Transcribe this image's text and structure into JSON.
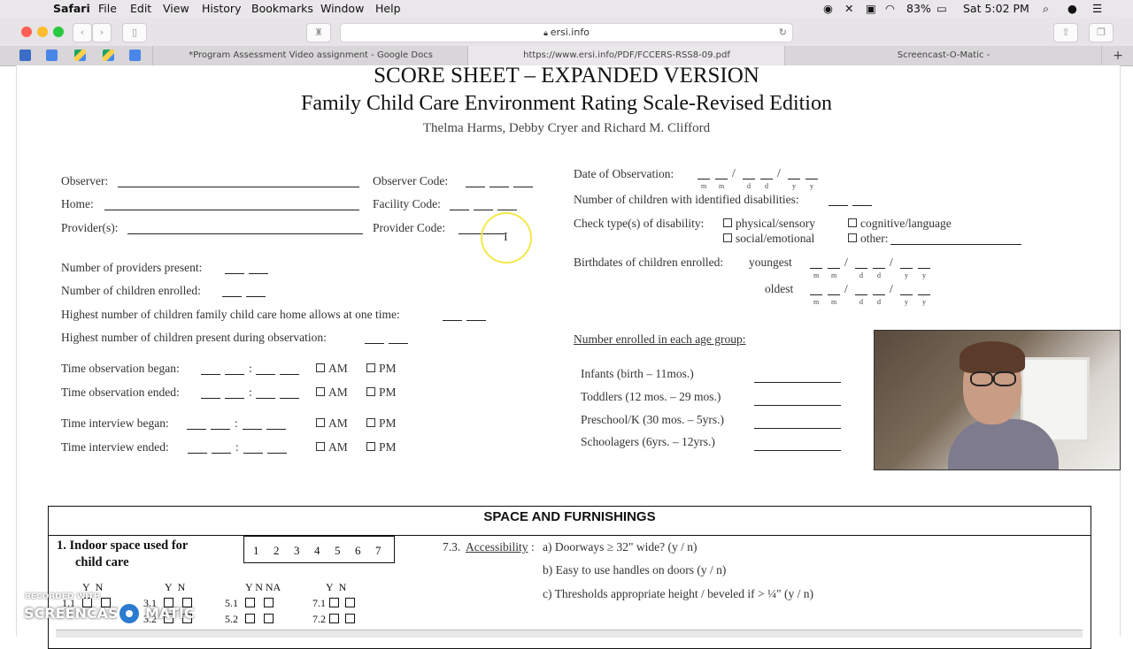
{
  "menubar": {
    "apple": "",
    "app": "Safari",
    "items": [
      "File",
      "Edit",
      "View",
      "History",
      "Bookmarks",
      "Window",
      "Help"
    ],
    "battery": "83%",
    "clock": "Sat 5:02 PM"
  },
  "toolbar": {
    "url": "ersi.info",
    "reader": "⟲"
  },
  "tabs": [
    {
      "label": "*Program Assessment Video assignment - Google Docs"
    },
    {
      "label": "https://www.ersi.info/PDF/FCCERS-RSS8-09.pdf"
    },
    {
      "label": "Screencast-O-Matic -"
    }
  ],
  "doc": {
    "title": "SCORE SHEET – EXPANDED VERSION",
    "subtitle": "Family Child Care Environment Rating Scale-Revised Edition",
    "authors": "Thelma Harms, Debby Cryer and Richard M. Clifford",
    "observer": "Observer:",
    "observer_code": "Observer Code:",
    "home": "Home:",
    "facility_code": "Facility Code:",
    "providers": "Provider(s):",
    "provider_code": "Provider Code:",
    "date_obs": "Date of Observation:",
    "date_sep": "/",
    "m": "m",
    "d": "d",
    "y": "y",
    "num_disab": "Number of children with identified disabilities:",
    "check_type": "Check type(s) of disability:",
    "dis_physical": "physical/sensory",
    "dis_cognitive": "cognitive/language",
    "dis_social": "social/emotional",
    "dis_other": "other:",
    "birthdates": "Birthdates of children enrolled:",
    "youngest": "youngest",
    "oldest": "oldest",
    "num_providers": "Number of providers present:",
    "num_enrolled": "Number of children enrolled:",
    "highest_allows": "Highest number of children family child care home allows at one time:",
    "highest_present": "Highest number of children present during observation:",
    "time_obs_began": "Time observation began:",
    "time_obs_ended": "Time observation ended:",
    "time_int_began": "Time interview began:",
    "time_int_ended": "Time interview ended:",
    "colon": ":",
    "am": "AM",
    "pm": "PM",
    "enrolled_age": "Number enrolled in each age group:",
    "infants": "Infants (birth – 11mos.)",
    "toddlers": "Toddlers (12 mos. – 29 mos.)",
    "preschool": "Preschool/K (30 mos. – 5yrs.)",
    "schoolagers": "Schoolagers (6yrs. – 12yrs.)",
    "section_title": "SPACE AND FURNISHINGS",
    "item1_a": "1.  Indoor space used for",
    "item1_b": "child care",
    "scale": [
      "1",
      "2",
      "3",
      "4",
      "5",
      "6",
      "7"
    ],
    "acc_num": "7.3.",
    "acc_label": "Accessibility",
    "acc_colon": ":",
    "acc_a": "a) Doorways ≥ 32\" wide?  (y / n)",
    "acc_b": "b) Easy to use handles on doors (y / n)",
    "acc_c": "c) Thresholds appropriate height / beveled if > ¼\" (y / n)",
    "yn": [
      "Y",
      "N"
    ],
    "ynna": "Y N NA",
    "row_labels": [
      "1.1",
      "3.1",
      "5.1",
      "7.1",
      "3.2",
      "5.2",
      "7.2"
    ]
  },
  "webcam_label": "webcam overlay",
  "watermark": {
    "line1": "RECORDED WITH",
    "line2_a": "SCREENCAST",
    "line2_b": "MATIC"
  },
  "colors": {
    "highlight": "#f3e94a",
    "accent_red": "#ff5f57",
    "accent_yellow": "#febc2e",
    "accent_green": "#28c840"
  }
}
